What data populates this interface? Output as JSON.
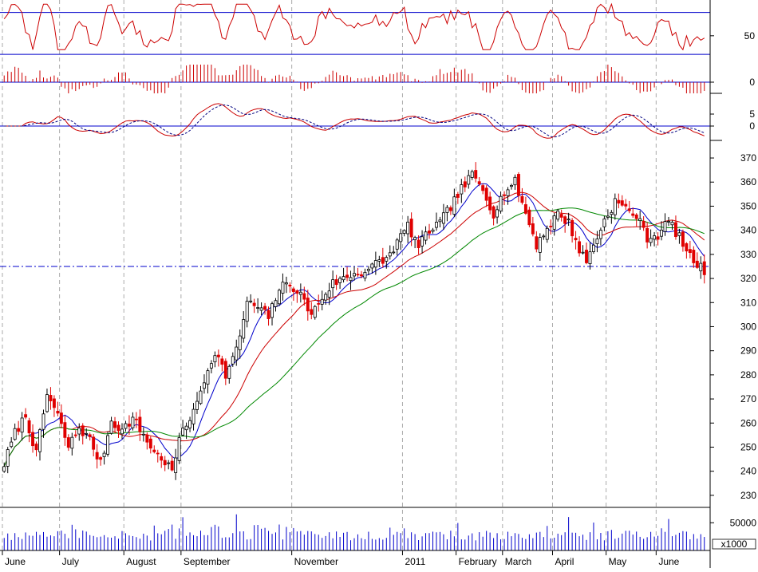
{
  "chart_data": {
    "type": "candlestick",
    "colors": {
      "up_candle": "#000000",
      "down_candle": "#e00000",
      "ma_short": "#0000cc",
      "ma_mid": "#cc0000",
      "ma_long": "#008800",
      "support_line": "#0000cc",
      "indicator": "#cc0000",
      "guide_line": "#0000cc",
      "grid": "#aaaaaa",
      "volume": "#0000cc"
    },
    "x_months": [
      "June",
      "July",
      "August",
      "September",
      "November",
      "2011",
      "February",
      "March",
      "April",
      "May",
      "June"
    ],
    "month_positions": [
      0,
      16,
      34,
      50,
      81,
      112,
      127,
      140,
      154,
      169,
      183
    ],
    "bars_total": 197,
    "price_axis": {
      "ticks": [
        "230",
        "240",
        "250",
        "260",
        "270",
        "280",
        "290",
        "300",
        "310",
        "320",
        "330",
        "340",
        "350",
        "360",
        "370"
      ],
      "ylim": [
        225,
        372
      ]
    },
    "support_level": 325,
    "price_anchors": [
      [
        0,
        243
      ],
      [
        3,
        256
      ],
      [
        6,
        263
      ],
      [
        9,
        247
      ],
      [
        12,
        272
      ],
      [
        15,
        263
      ],
      [
        18,
        250
      ],
      [
        21,
        258
      ],
      [
        24,
        253
      ],
      [
        27,
        243
      ],
      [
        30,
        261
      ],
      [
        33,
        257
      ],
      [
        36,
        262
      ],
      [
        39,
        255
      ],
      [
        42,
        248
      ],
      [
        45,
        244
      ],
      [
        47,
        240
      ],
      [
        50,
        258
      ],
      [
        53,
        264
      ],
      [
        56,
        278
      ],
      [
        59,
        290
      ],
      [
        62,
        280
      ],
      [
        65,
        290
      ],
      [
        68,
        310
      ],
      [
        71,
        308
      ],
      [
        74,
        304
      ],
      [
        77,
        316
      ],
      [
        80,
        318
      ],
      [
        83,
        313
      ],
      [
        86,
        305
      ],
      [
        89,
        312
      ],
      [
        92,
        318
      ],
      [
        95,
        320
      ],
      [
        98,
        322
      ],
      [
        101,
        323
      ],
      [
        104,
        326
      ],
      [
        107,
        328
      ],
      [
        110,
        335
      ],
      [
        113,
        342
      ],
      [
        116,
        333
      ],
      [
        119,
        340
      ],
      [
        122,
        343
      ],
      [
        125,
        350
      ],
      [
        128,
        357
      ],
      [
        131,
        363
      ],
      [
        134,
        357
      ],
      [
        137,
        347
      ],
      [
        140,
        356
      ],
      [
        143,
        360
      ],
      [
        146,
        347
      ],
      [
        149,
        334
      ],
      [
        152,
        341
      ],
      [
        155,
        347
      ],
      [
        158,
        343
      ],
      [
        161,
        332
      ],
      [
        163,
        327
      ],
      [
        165,
        334
      ],
      [
        168,
        344
      ],
      [
        171,
        352
      ],
      [
        174,
        349
      ],
      [
        177,
        346
      ],
      [
        180,
        337
      ],
      [
        183,
        338
      ],
      [
        186,
        344
      ],
      [
        189,
        337
      ],
      [
        192,
        329
      ],
      [
        194,
        326
      ],
      [
        196,
        323
      ]
    ],
    "volume_axis": {
      "tick": "50000",
      "unit": "x1000"
    },
    "volume_seed_levels": [
      18000,
      32000,
      55000
    ],
    "rsi_panel": {
      "ticks": [
        "50"
      ],
      "guide_levels": [
        75,
        30
      ]
    },
    "macd_hist_panel": {
      "ticks": [
        "0"
      ]
    },
    "macd_panel": {
      "ticks": [
        "5",
        "0"
      ]
    }
  }
}
